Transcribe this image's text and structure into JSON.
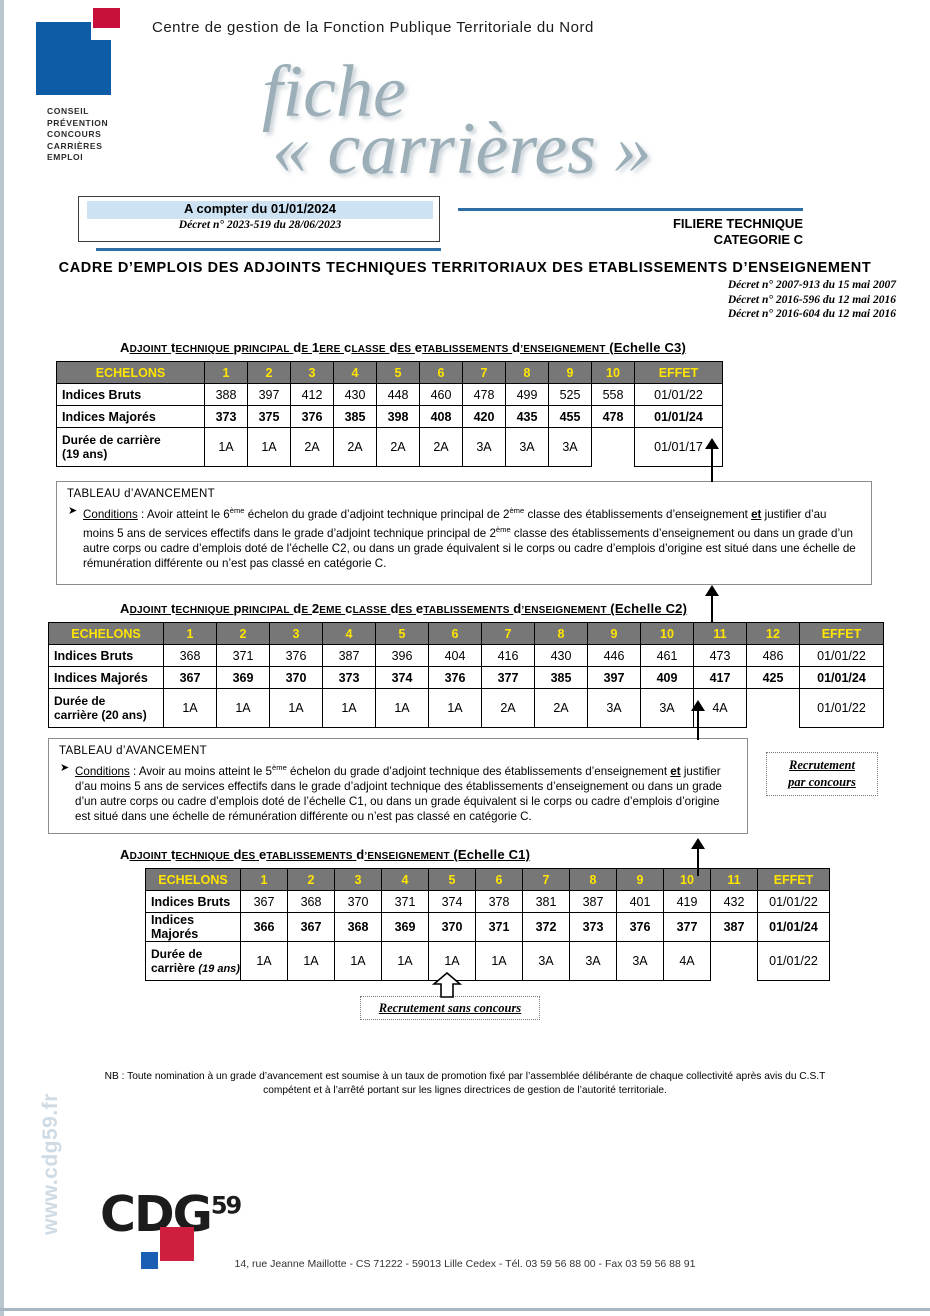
{
  "header": {
    "org_title": "Centre de gestion de la Fonction Publique Territoriale du Nord",
    "logo_words": "CONSEIL\nPRÉVENTION\nCONCOURS\nCARRIÈRES\nEMPLOI",
    "fiche_word": "fiche",
    "carrieres_word": "« carrières »",
    "brand_blue": "#0d5ca5",
    "brand_red": "#c8103c",
    "title_gray_blue": "#9cafb8"
  },
  "datebox": {
    "line1": "A compter du 01/01/2024",
    "line2": "Décret n° 2023-519 du 28/06/2023",
    "highlight_color": "#cde3f4"
  },
  "filiere": {
    "line1": "FILIERE TECHNIQUE",
    "line2": "CATEGORIE C"
  },
  "cadre": {
    "title": "CADRE  D’EMPLOIS  DES  ADJOINTS  TECHNIQUES  TERRITORIAUX  DES  ETABLISSEMENTS  D’ENSEIGNEMENT",
    "decrets": [
      "Décret n° 2007-913 du 15 mai 2007",
      "Décret n° 2016-596 du 12 mai  2016",
      "Décret n° 2016-604 du 12 mai  2016"
    ]
  },
  "grades": [
    {
      "id": "c3",
      "title_prefix": "Adjoint  technique  principal  de  1ere  classe  des  etablissements  d’enseignement",
      "title_scale": "(Echelle  C3)",
      "row_labels": [
        "ECHELONS",
        "Indices Bruts",
        "Indices Majorés",
        "Durée de carrière"
      ],
      "duration_note": "(19 ans)",
      "effet_label": "EFFET",
      "echelons": [
        "1",
        "2",
        "3",
        "4",
        "5",
        "6",
        "7",
        "8",
        "9",
        "10"
      ],
      "indices_bruts": [
        "388",
        "397",
        "412",
        "430",
        "448",
        "460",
        "478",
        "499",
        "525",
        "558"
      ],
      "indices_majores": [
        "373",
        "375",
        "376",
        "385",
        "398",
        "408",
        "420",
        "435",
        "455",
        "478"
      ],
      "duree": [
        "1A",
        "1A",
        "2A",
        "2A",
        "2A",
        "2A",
        "3A",
        "3A",
        "3A",
        ""
      ],
      "effet_bruts": "01/01/22",
      "effet_majores": "01/01/24",
      "effet_duree": "01/01/17"
    },
    {
      "id": "c2",
      "title_prefix": "Adjoint  technique  principal  de  2eme  classe  des  etablissements  d’enseignement",
      "title_scale": "(Echelle  C2)",
      "row_labels": [
        "ECHELONS",
        "Indices Bruts",
        "Indices Majorés",
        "Durée de"
      ],
      "duration_note": "carrière (20 ans)",
      "effet_label": "EFFET",
      "echelons": [
        "1",
        "2",
        "3",
        "4",
        "5",
        "6",
        "7",
        "8",
        "9",
        "10",
        "11",
        "12"
      ],
      "indices_bruts": [
        "368",
        "371",
        "376",
        "387",
        "396",
        "404",
        "416",
        "430",
        "446",
        "461",
        "473",
        "486"
      ],
      "indices_majores": [
        "367",
        "369",
        "370",
        "373",
        "374",
        "376",
        "377",
        "385",
        "397",
        "409",
        "417",
        "425"
      ],
      "duree": [
        "1A",
        "1A",
        "1A",
        "1A",
        "1A",
        "1A",
        "2A",
        "2A",
        "3A",
        "3A",
        "4A",
        ""
      ],
      "effet_bruts": "01/01/22",
      "effet_majores": "01/01/24",
      "effet_duree": "01/01/22"
    },
    {
      "id": "c1",
      "title_prefix": "Adjoint  technique  des  etablissements  d’enseignement",
      "title_scale": "(Echelle  C1)",
      "row_labels": [
        "ECHELONS",
        "Indices Bruts",
        "Indices Majorés",
        "Durée de"
      ],
      "duration_note": "carrière (19 ans)",
      "effet_label": "EFFET",
      "echelons": [
        "1",
        "2",
        "3",
        "4",
        "5",
        "6",
        "7",
        "8",
        "9",
        "10",
        "11"
      ],
      "indices_bruts": [
        "367",
        "368",
        "370",
        "371",
        "374",
        "378",
        "381",
        "387",
        "401",
        "419",
        "432"
      ],
      "indices_majores": [
        "366",
        "367",
        "368",
        "369",
        "370",
        "371",
        "372",
        "373",
        "376",
        "377",
        "387"
      ],
      "duree": [
        "1A",
        "1A",
        "1A",
        "1A",
        "1A",
        "1A",
        "3A",
        "3A",
        "3A",
        "4A",
        ""
      ],
      "effet_bruts": "01/01/22",
      "effet_majores": "01/01/24",
      "effet_duree": "01/01/22"
    }
  ],
  "advancement": [
    {
      "id": "adv1",
      "heading": "Tableau  d’avancement",
      "conditions_label": "Conditions",
      "text_html": " : Avoir atteint le 6<sup>ème</sup> échelon du grade d’adjoint technique principal de 2<sup>ème</sup> classe des établissements d’enseignement <b class=\"u\">et</b> justifier d’au moins 5 ans de services effectifs dans le grade d’adjoint technique principal de 2<sup>ème</sup> classe des établissements d’enseignement ou dans un grade d’un autre corps ou cadre d’emplois doté de l’échelle C2, ou dans un grade équivalent si le corps ou cadre d’emplois d’origine est situé dans une échelle de rémunération différente ou n’est pas classé en catégorie C."
    },
    {
      "id": "adv2",
      "heading": "Tableau  d’avancement",
      "conditions_label": "Conditions",
      "text_html": " : Avoir au moins atteint le 5<sup>ème</sup> échelon du grade d’adjoint technique des établissements d’enseignement <b class=\"u\">et</b> justifier d’au moins 5 ans de services effectifs dans le grade d’adjoint technique des établissements d’enseignement ou dans un grade d’un autre corps ou cadre d’emplois doté de l’échelle C1, ou dans un grade équivalent si le corps ou cadre d’emplois d’origine est situé dans une échelle de rémunération différente ou n’est pas classé en catégorie C."
    }
  ],
  "recruitment": {
    "concours_line1": "Recrutement",
    "concours_line2": "par concours",
    "sans_concours": "Recrutement sans concours"
  },
  "footer": {
    "nb_line1": "NB : Toute nomination à un grade d’avancement est soumise à un taux de promotion fixé par l’assemblée délibérante de chaque collectivité après avis du C.S.T",
    "nb_line2": "compétent et à l’arrêté portant sur les lignes directrices de gestion de l’autorité territoriale.",
    "website": "www.cdg59.fr",
    "logo_main": "CDG",
    "logo_sup": "59",
    "address": "14, rue Jeanne Maillotte - CS 71222 - 59013 Lille Cedex - Tél. 03 59 56 88 00 - Fax 03 59 56 88 91"
  }
}
